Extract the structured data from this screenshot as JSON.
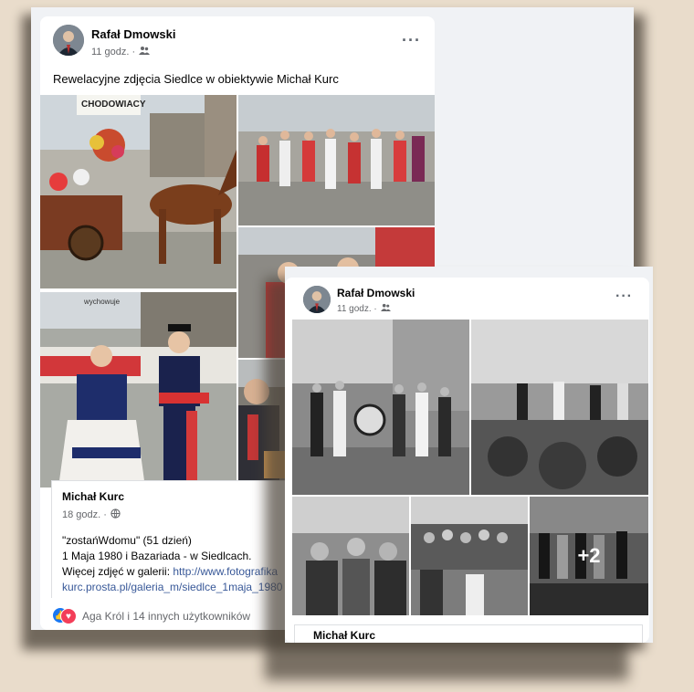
{
  "post_main": {
    "author": "Rafał Dmowski",
    "time": "11 godz. ·",
    "audience_icon": "friends-icon",
    "menu_icon": "more-options-icon",
    "text": "Rewelacyjne zdjęcia Siedlce w obiektywie Michał Kurc",
    "photos": [
      {
        "caption": "CHODOWIACY"
      },
      {
        "caption": ""
      },
      {
        "caption": ""
      },
      {
        "caption": "wychowuje"
      },
      {
        "caption": ""
      },
      {
        "caption": ""
      }
    ],
    "shared": {
      "author": "Michał Kurc",
      "time": "18 godz. ·",
      "privacy_icon": "globe-icon",
      "line1": "\"zostańWdomu\" (51 dzień)",
      "line2": "1 Maja 1980 i Bazariada - w Siedlcach.",
      "line3_prefix": "Więcej zdjęć w galerii: ",
      "link_part1": "http://www.fotografika",
      "link_part2": "kurc.prosta.pl/galeria_m/siedlce_1maja_1980"
    },
    "reactions_text": "Aga Król i 14 innych użytkowników",
    "reaction_colors": {
      "like": "#1877f2",
      "love": "#f33e58"
    }
  },
  "post_overlay": {
    "author": "Rafał Dmowski",
    "time": "11 godz. ·",
    "audience_icon": "friends-icon",
    "menu_icon": "more-options-icon",
    "more_photos": "+2",
    "shared_author": "Michał Kurc"
  }
}
